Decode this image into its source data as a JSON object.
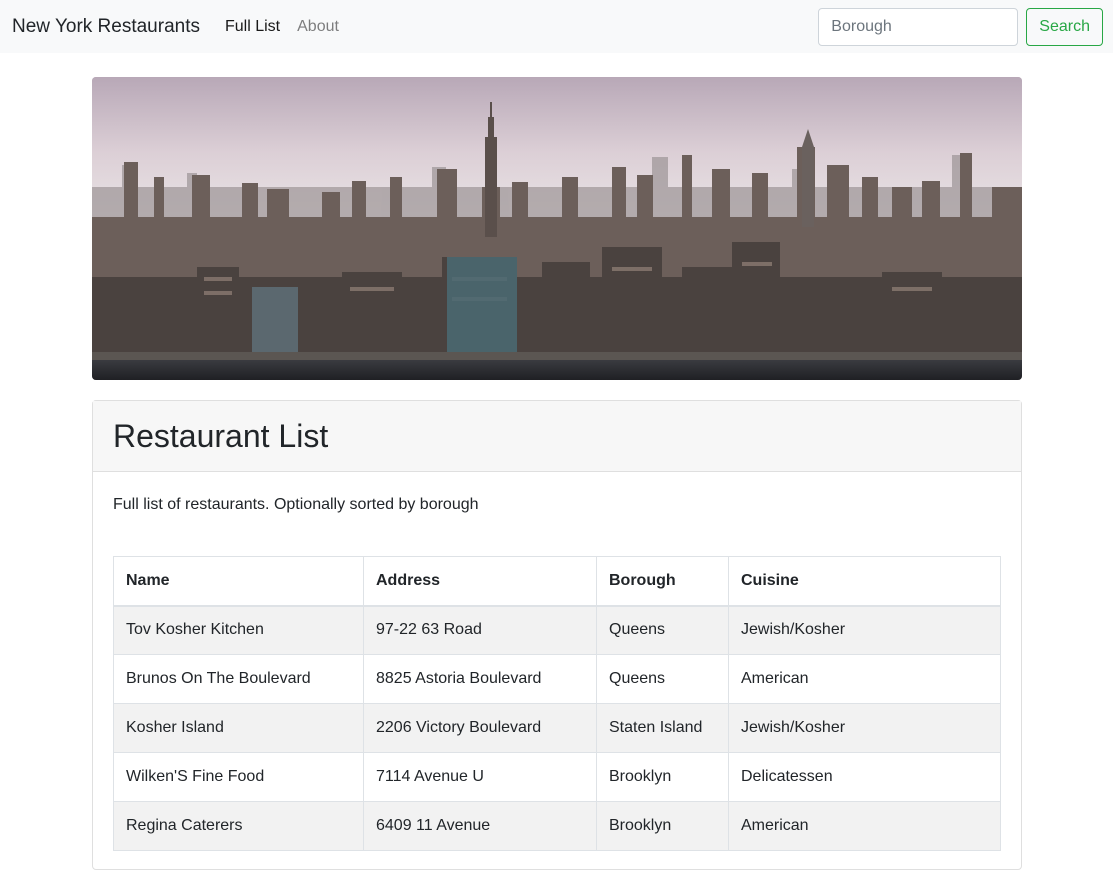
{
  "navbar": {
    "brand": "New York Restaurants",
    "links": [
      "Full List",
      "About"
    ],
    "search_placeholder": "Borough",
    "search_button": "Search"
  },
  "hero": {
    "image": "new-york-skyline"
  },
  "card": {
    "title": "Restaurant List",
    "description": "Full list of restaurants. Optionally sorted by borough"
  },
  "table": {
    "headers": [
      "Name",
      "Address",
      "Borough",
      "Cuisine"
    ],
    "rows": [
      [
        "Tov Kosher Kitchen",
        "97-22 63 Road",
        "Queens",
        "Jewish/Kosher"
      ],
      [
        "Brunos On The Boulevard",
        "8825 Astoria Boulevard",
        "Queens",
        "American"
      ],
      [
        "Kosher Island",
        "2206 Victory Boulevard",
        "Staten Island",
        "Jewish/Kosher"
      ],
      [
        "Wilken'S Fine Food",
        "7114 Avenue U",
        "Brooklyn",
        "Delicatessen"
      ],
      [
        "Regina Caterers",
        "6409 11 Avenue",
        "Brooklyn",
        "American"
      ]
    ]
  }
}
